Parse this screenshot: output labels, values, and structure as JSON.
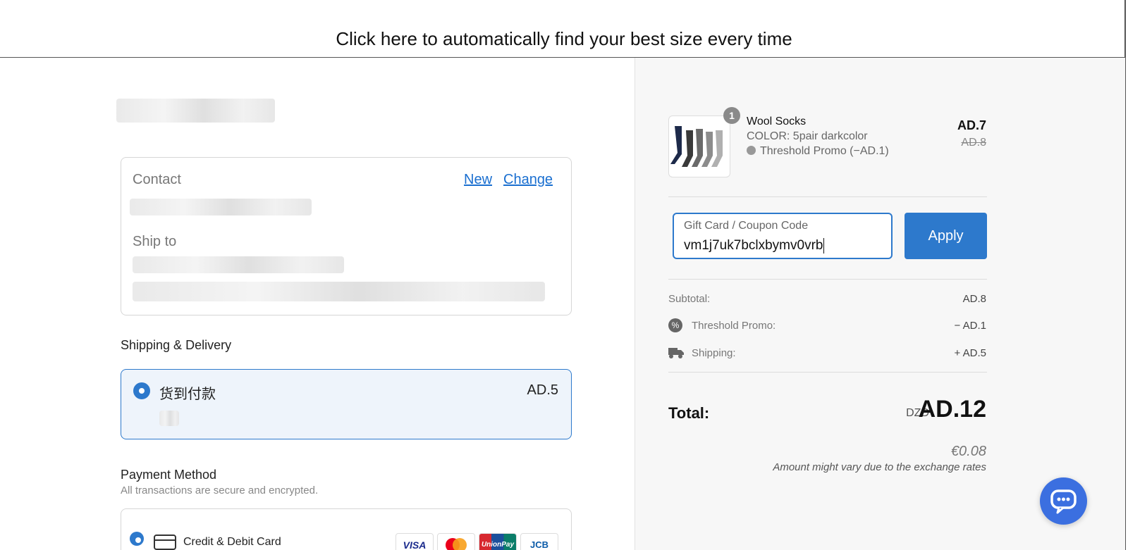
{
  "banner": {
    "text": "Click here to automatically find your best size every time"
  },
  "contact_card": {
    "contact_label": "Contact",
    "new_link": "New",
    "change_link": "Change",
    "ship_to_label": "Ship to"
  },
  "shipping": {
    "title": "Shipping & Delivery",
    "option_name": "货到付款",
    "option_price": "AD.5"
  },
  "payment": {
    "title": "Payment Method",
    "subtitle": "All transactions are secure and encrypted.",
    "option_label": "Credit & Debit Card",
    "brands": [
      "VISA",
      "Mastercard",
      "UnionPay",
      "JCB"
    ]
  },
  "order": {
    "item": {
      "name": "Wool Socks",
      "variant": "COLOR: 5pair darkcolor",
      "promo": "Threshold Promo (−AD.1)",
      "price": "AD.7",
      "original_price": "AD.8",
      "quantity": "1"
    },
    "coupon": {
      "label": "Gift Card / Coupon Code",
      "value": "vm1j7uk7bclxbymv0vrb",
      "apply_label": "Apply"
    },
    "summary": {
      "subtotal_label": "Subtotal:",
      "subtotal_value": "AD.8",
      "promo_label": "Threshold Promo:",
      "promo_value": "− AD.1",
      "shipping_label": "Shipping:",
      "shipping_value": "+ AD.5"
    },
    "total": {
      "label": "Total:",
      "currency": "DZD",
      "value": "AD.12",
      "converted": "€0.08",
      "note": "Amount might vary due to the exchange rates"
    }
  },
  "colors": {
    "accent": "#2d79cc",
    "link": "#1a6fd0",
    "chat": "#3b6fe0"
  }
}
